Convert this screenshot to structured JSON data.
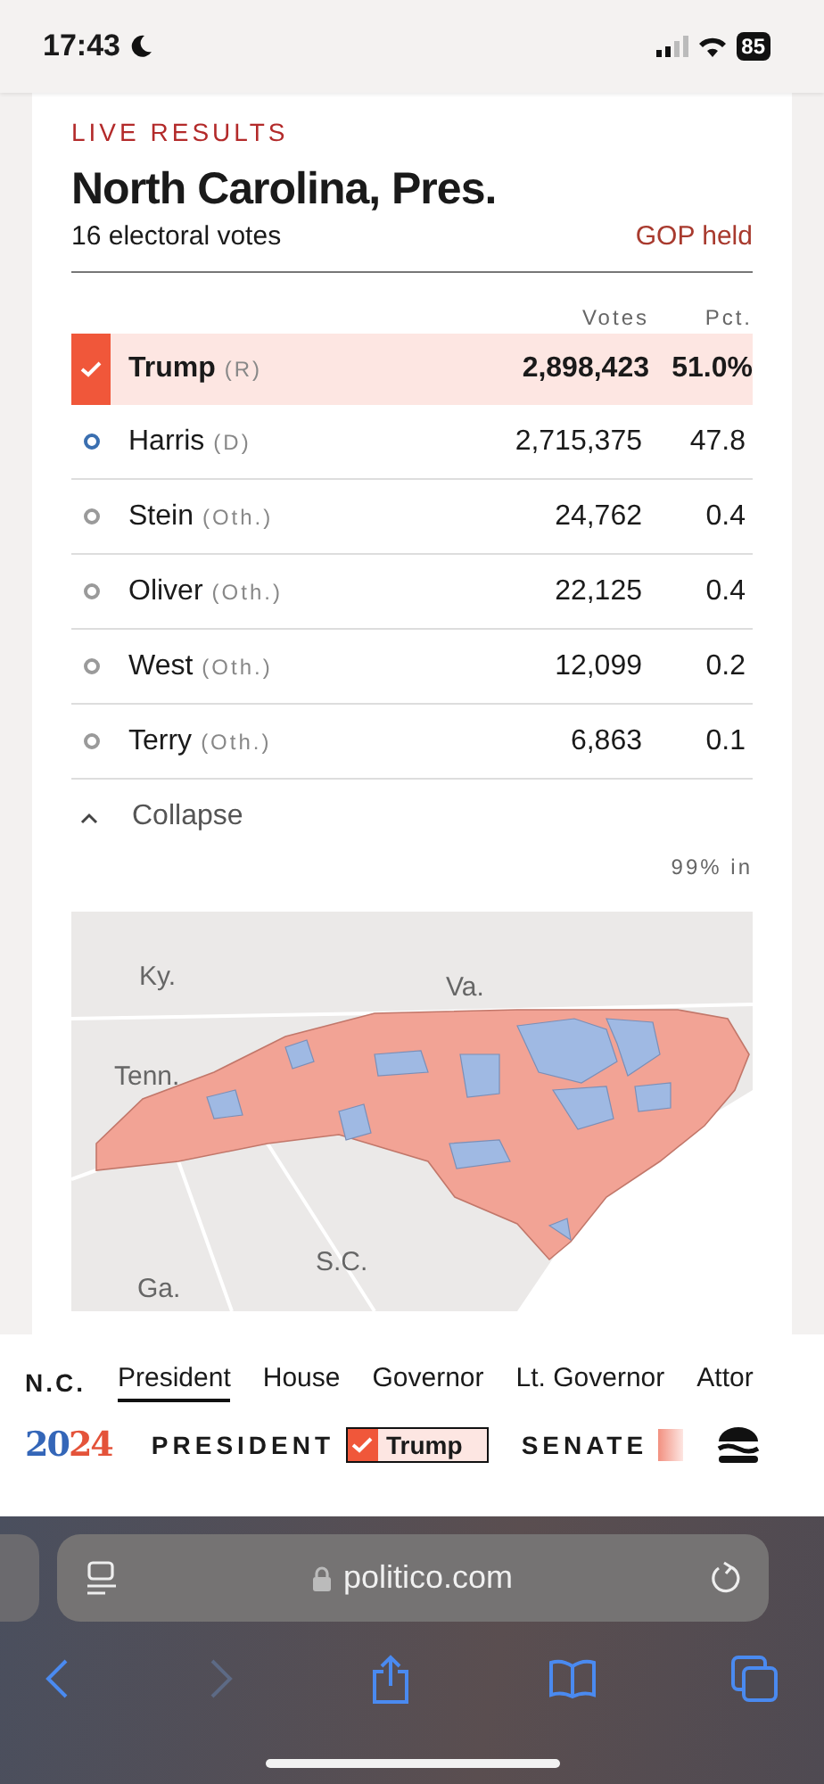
{
  "status_bar": {
    "time": "17:43",
    "battery": "85"
  },
  "race": {
    "kicker": "LIVE RESULTS",
    "title": "North Carolina, Pres.",
    "subtitle": "16 electoral votes",
    "held": "GOP held"
  },
  "table": {
    "columns": [
      "Votes",
      "Pct."
    ],
    "rows": [
      {
        "name": "Trump",
        "party": "(R)",
        "votes": "2,898,423",
        "pct": "51.0%",
        "winner": true,
        "color": "#f0573a"
      },
      {
        "name": "Harris",
        "party": "(D)",
        "votes": "2,715,375",
        "pct": "47.8",
        "winner": false,
        "color": "#3a6fb0"
      },
      {
        "name": "Stein",
        "party": "(Oth.)",
        "votes": "24,762",
        "pct": "0.4",
        "winner": false,
        "color": "#9a9a9a"
      },
      {
        "name": "Oliver",
        "party": "(Oth.)",
        "votes": "22,125",
        "pct": "0.4",
        "winner": false,
        "color": "#9a9a9a"
      },
      {
        "name": "West",
        "party": "(Oth.)",
        "votes": "12,099",
        "pct": "0.2",
        "winner": false,
        "color": "#9a9a9a"
      },
      {
        "name": "Terry",
        "party": "(Oth.)",
        "votes": "6,863",
        "pct": "0.1",
        "winner": false,
        "color": "#9a9a9a"
      }
    ]
  },
  "collapse": {
    "label": "Collapse",
    "expanded": true
  },
  "reporting": "99% in",
  "map": {
    "labels": [
      "Ky.",
      "Va.",
      "Tenn.",
      "S.C.",
      "Ga."
    ]
  },
  "nav": {
    "state": "N.C.",
    "tabs": [
      {
        "label": "President",
        "selected": true
      },
      {
        "label": "House",
        "selected": false
      },
      {
        "label": "Governor",
        "selected": false
      },
      {
        "label": "Lt. Governor",
        "selected": false
      },
      {
        "label": "Attor",
        "selected": false
      }
    ]
  },
  "ticker": {
    "logo": "2024",
    "items": [
      {
        "label": "PRESIDENT",
        "leader": "Trump"
      },
      {
        "label": "SENATE"
      }
    ]
  },
  "browser": {
    "url": "politico.com",
    "forward_disabled": true
  }
}
